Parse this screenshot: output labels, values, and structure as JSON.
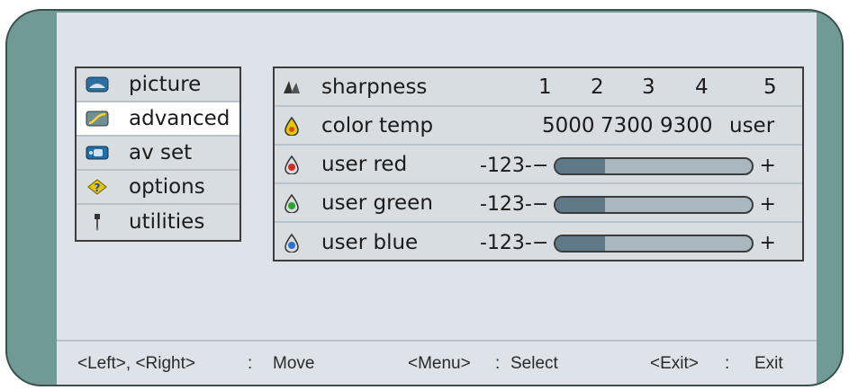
{
  "menu": {
    "items": [
      {
        "label": "picture",
        "icon": "picture-icon",
        "active": false
      },
      {
        "label": "advanced",
        "icon": "advanced-icon",
        "active": true
      },
      {
        "label": "av set",
        "icon": "av-set-icon",
        "active": false
      },
      {
        "label": "options",
        "icon": "options-icon",
        "active": false
      },
      {
        "label": "utilities",
        "icon": "utilities-icon",
        "active": false
      }
    ]
  },
  "panel": {
    "sharpness": {
      "label": "sharpness",
      "icon": "sharpness-icon",
      "levels": [
        "1",
        "2",
        "3",
        "4",
        "5"
      ]
    },
    "color_temp": {
      "label": "color temp",
      "icon": "color-temp-icon",
      "options": [
        "5000",
        "7300",
        "9300",
        "user"
      ]
    },
    "user_red": {
      "label": "user red",
      "icon": "red-drop-icon",
      "value": "-123-",
      "minus": "−",
      "plus": "+",
      "level": 0.25
    },
    "user_green": {
      "label": "user green",
      "icon": "green-drop-icon",
      "value": "-123-",
      "minus": "−",
      "plus": "+",
      "level": 0.25
    },
    "user_blue": {
      "label": "user blue",
      "icon": "blue-drop-icon",
      "value": "-123-",
      "minus": "−",
      "plus": "+",
      "level": 0.25
    }
  },
  "footer": {
    "nav_keys": "<Left>, <Right>",
    "sep1": ":",
    "nav_action": "Move",
    "select_key": "<Menu>",
    "sep2": ":",
    "select_action": "Select",
    "exit_key": "<Exit>",
    "sep3": ":",
    "exit_action": "Exit"
  },
  "colors": {
    "frame": "#6f9a95",
    "screen": "#dde3e8",
    "slider_fill": "#5f7a86",
    "slider_track": "#a9b7bf"
  }
}
